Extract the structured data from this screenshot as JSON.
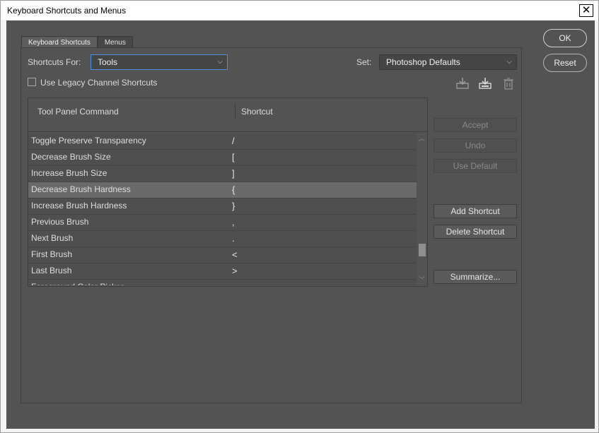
{
  "window": {
    "title": "Keyboard Shortcuts and Menus",
    "close_glyph": "✕"
  },
  "tabs": [
    {
      "label": "Keyboard Shortcuts"
    },
    {
      "label": "Menus"
    }
  ],
  "shortcuts_for": {
    "label": "Shortcuts For:",
    "value": "Tools"
  },
  "set": {
    "label": "Set:",
    "value": "Photoshop Defaults"
  },
  "legacy": {
    "label": "Use Legacy Channel Shortcuts",
    "checked": false
  },
  "icons": [
    "save-set-icon",
    "save-as-new-set-icon",
    "delete-set-icon"
  ],
  "table": {
    "col_command": "Tool Panel Command",
    "col_shortcut": "Shortcut",
    "rows": [
      {
        "command": "Toggle Preserve Transparency",
        "shortcut": "/"
      },
      {
        "command": "Decrease Brush Size",
        "shortcut": "["
      },
      {
        "command": "Increase Brush Size",
        "shortcut": "]"
      },
      {
        "command": "Decrease Brush Hardness",
        "shortcut": "{"
      },
      {
        "command": "Increase Brush Hardness",
        "shortcut": "}"
      },
      {
        "command": "Previous Brush",
        "shortcut": ","
      },
      {
        "command": "Next Brush",
        "shortcut": "."
      },
      {
        "command": "First Brush",
        "shortcut": "<"
      },
      {
        "command": "Last Brush",
        "shortcut": ">"
      },
      {
        "command": "Foreground Color Picker",
        "shortcut": ""
      }
    ],
    "selected_index": 3
  },
  "side_buttons": {
    "accept": "Accept",
    "undo": "Undo",
    "use_default": "Use Default",
    "add_shortcut": "Add Shortcut",
    "delete_shortcut": "Delete Shortcut",
    "summarize": "Summarize..."
  },
  "dialog_buttons": {
    "ok": "OK",
    "reset": "Reset"
  }
}
